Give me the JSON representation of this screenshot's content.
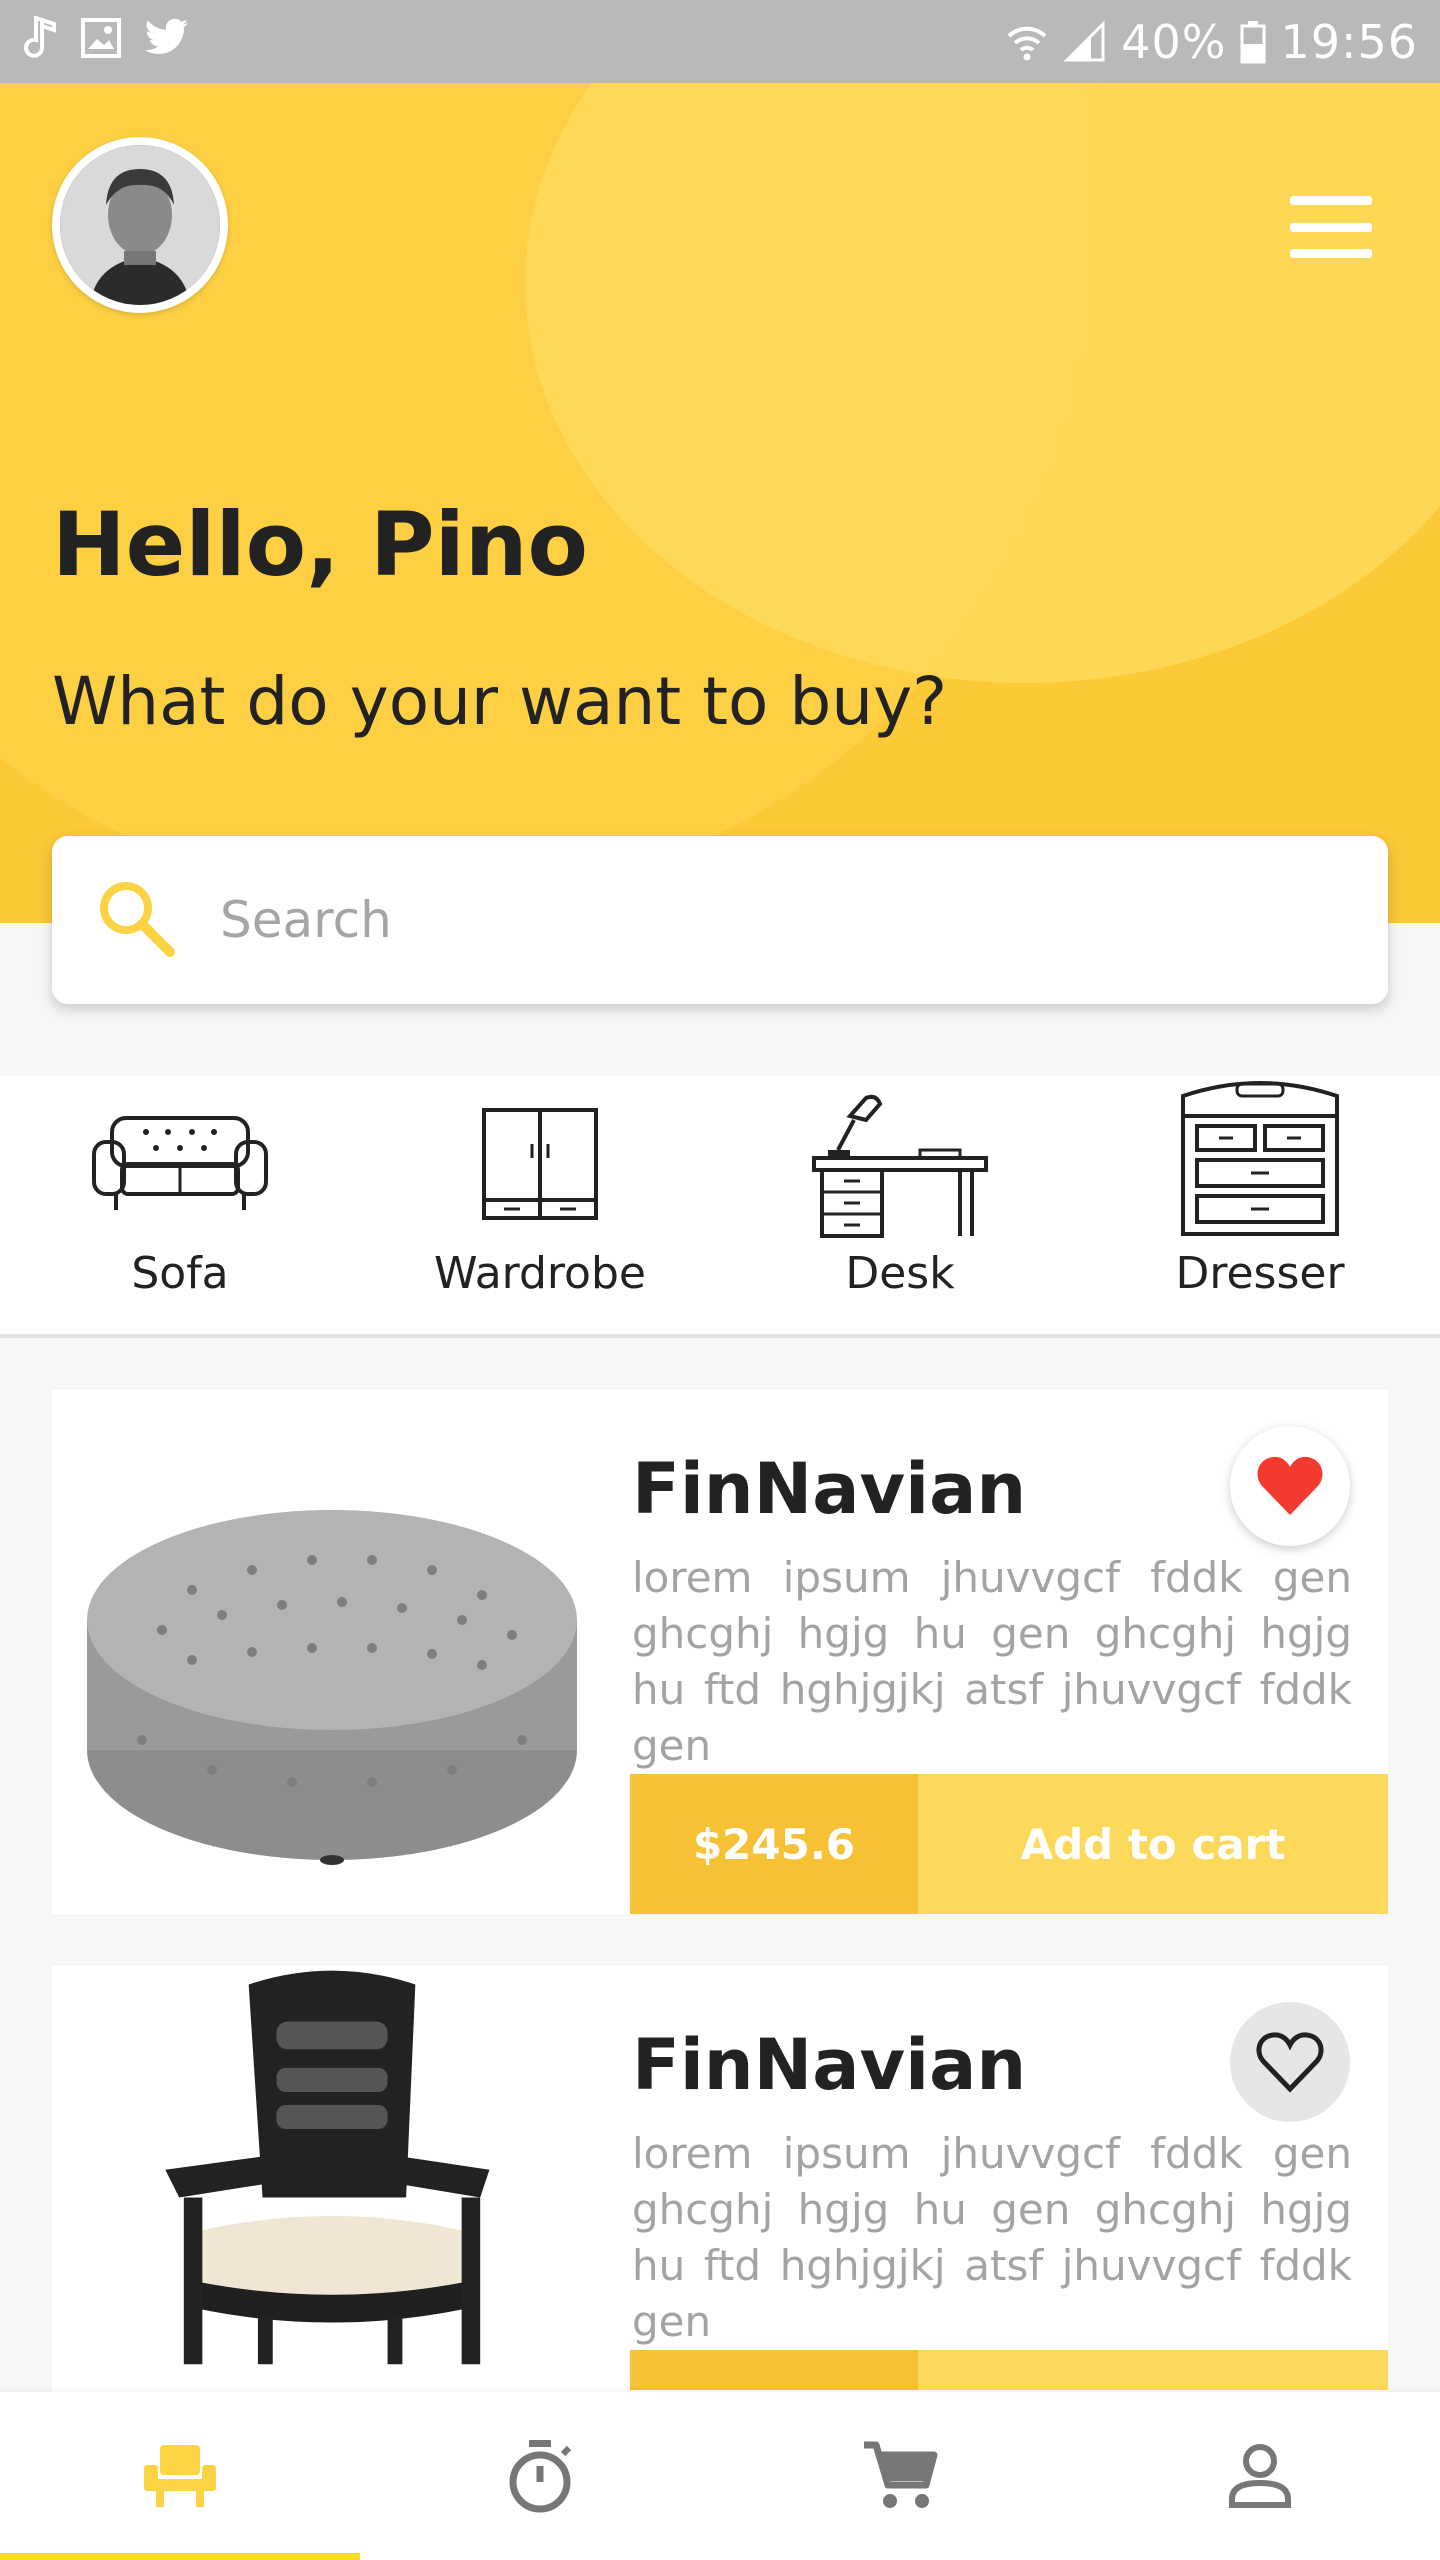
{
  "status_bar": {
    "battery": "40%",
    "time": "19:56",
    "icons": [
      "music-note-icon",
      "image-icon",
      "twitter-icon",
      "wifi-icon",
      "signal-icon",
      "battery-icon"
    ]
  },
  "header": {
    "greeting": "Hello, Pino",
    "subtitle": "What do your want to buy?",
    "accent_color": "#fcc937"
  },
  "search": {
    "placeholder": "Search"
  },
  "categories": [
    {
      "label": "Sofa",
      "icon": "sofa-icon"
    },
    {
      "label": "Wardrobe",
      "icon": "wardrobe-icon"
    },
    {
      "label": "Desk",
      "icon": "desk-icon"
    },
    {
      "label": "Dresser",
      "icon": "dresser-icon"
    }
  ],
  "products": [
    {
      "title": "FinNavian",
      "description": "lorem ipsum jhuvvgcf fddk gen ghcghj hgjg hu gen ghcghj hgjg hu ftd hghjgjkj atsf jhuvvgcf fddk gen",
      "price": "$245.6",
      "cta": "Add to cart",
      "favorite": true
    },
    {
      "title": "FinNavian",
      "description": "lorem ipsum jhuvvgcf fddk gen ghcghj hgjg hu gen ghcghj hgjg hu ftd hghjgjkj atsf jhuvvgcf fddk gen",
      "favorite": false
    }
  ],
  "bottom_nav": {
    "items": [
      "chair-icon",
      "timer-icon",
      "cart-icon",
      "profile-icon"
    ],
    "active_index": 0
  }
}
